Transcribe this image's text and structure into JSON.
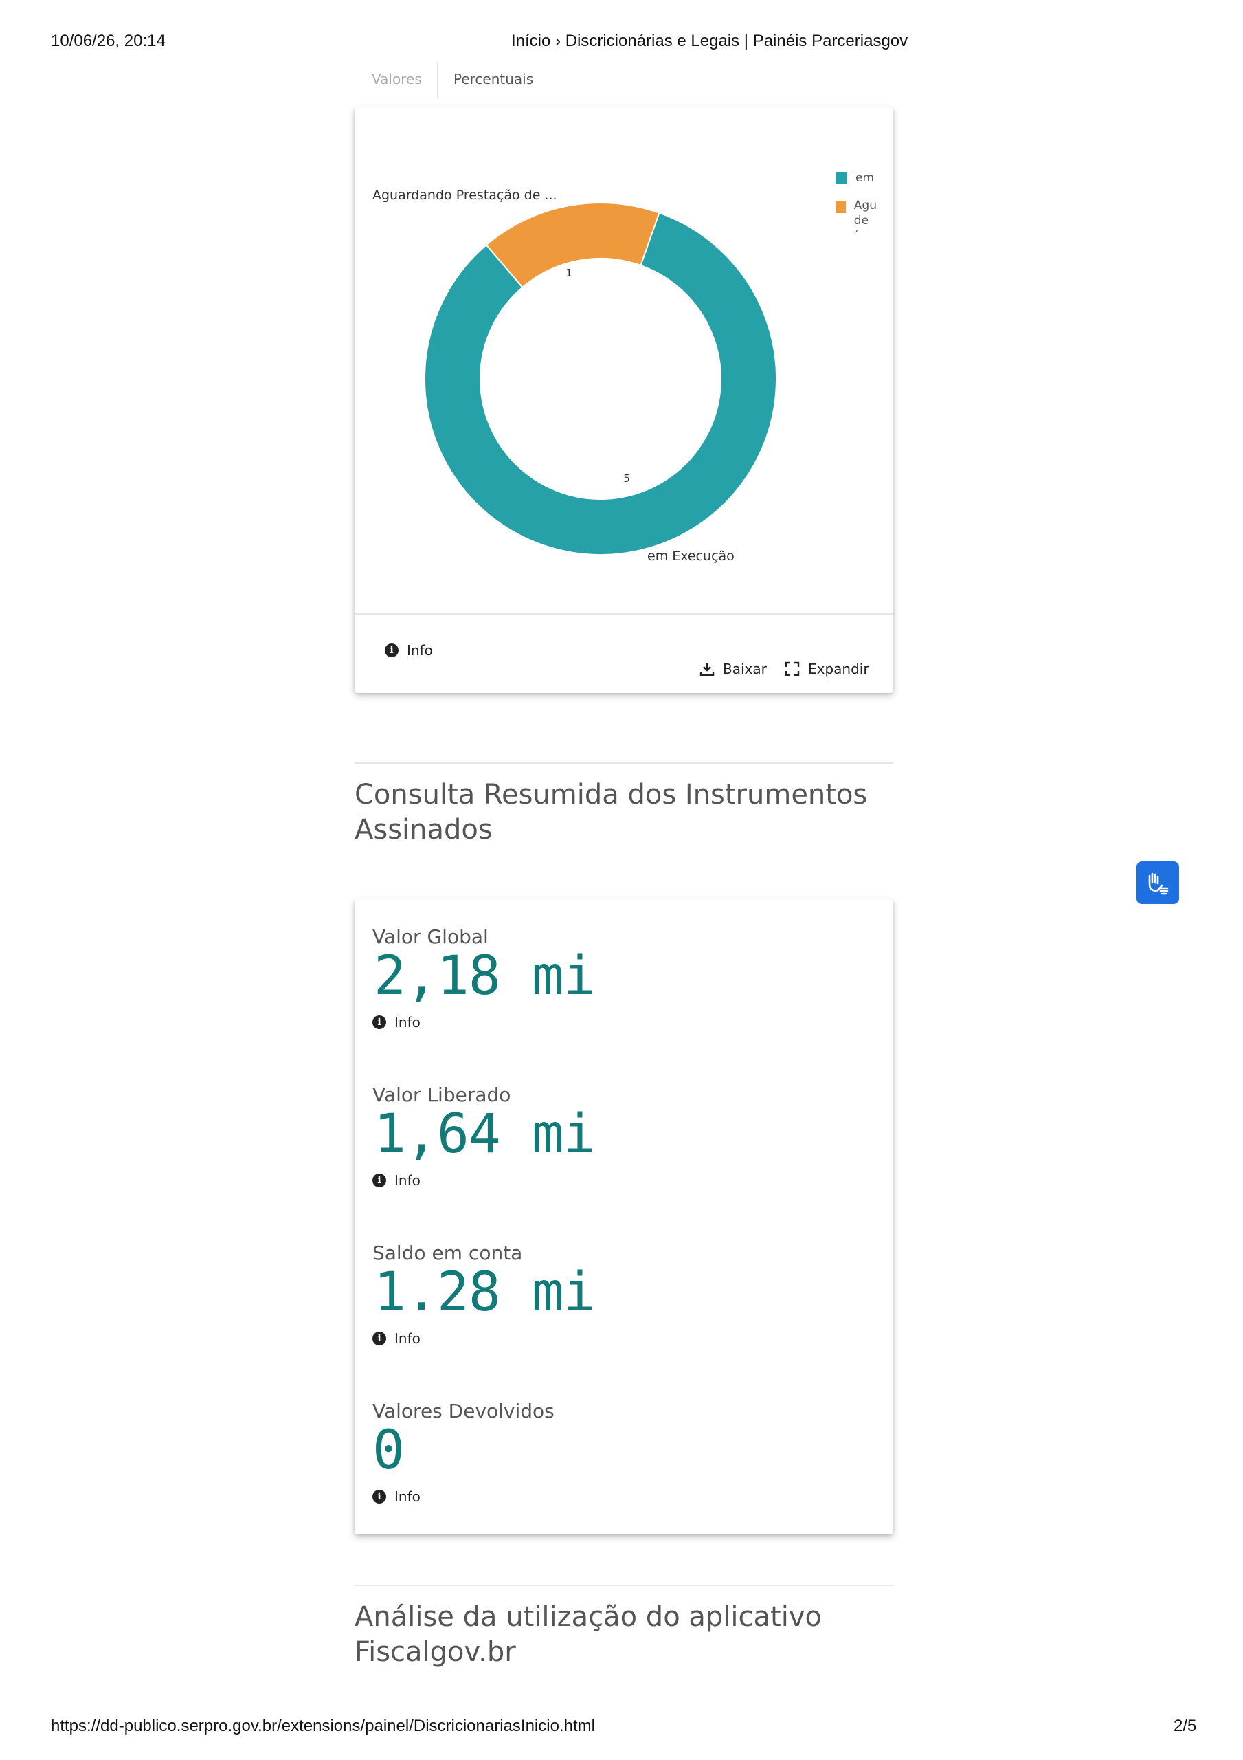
{
  "print_header": {
    "datetime": "10/06/26, 20:14",
    "page_title": "Início › Discricionárias e Legais | Painéis Parceriasgov"
  },
  "print_footer": {
    "url": "https://dd-publico.serpro.gov.br/extensions/painel/DiscricionariasInicio.html",
    "page": "2/5"
  },
  "tabs": [
    {
      "label": "Valores",
      "state": "inactive"
    },
    {
      "label": "Percentuais",
      "state": "active"
    }
  ],
  "chart_card": {
    "legend": [
      {
        "label": "em",
        "color": "#26a1a8"
      },
      {
        "label": "Agu",
        "label2": "de (",
        "color": "#ee9a3c"
      }
    ],
    "footer": {
      "info": "Info",
      "download": "Baixar",
      "expand": "Expandir"
    }
  },
  "chart_data": {
    "type": "pie",
    "variant": "donut",
    "slices": [
      {
        "label": "em Execução",
        "value": 5,
        "color": "#26a1a8"
      },
      {
        "label": "Aguardando Prestação de ...",
        "value": 1,
        "color": "#ee9a3c"
      }
    ]
  },
  "sections": {
    "summary_title_line1": "Consulta Resumida dos Instrumentos",
    "summary_title_line2": "Assinados",
    "usage_title_line1": "Análise da utilização do aplicativo",
    "usage_title_line2": "Fiscalgov.br"
  },
  "kpis": [
    {
      "label": "Valor Global",
      "value": "2,18 mi",
      "info": "Info"
    },
    {
      "label": "Valor Liberado",
      "value": "1,64 mi",
      "info": "Info"
    },
    {
      "label": "Saldo em conta",
      "value": "1.28 mi",
      "info": "Info"
    },
    {
      "label": "Valores Devolvidos",
      "value": "0",
      "info": "Info"
    }
  ],
  "accessibility_button": {
    "icon": "sign-language-hands-icon",
    "color": "#1e6fe0"
  }
}
